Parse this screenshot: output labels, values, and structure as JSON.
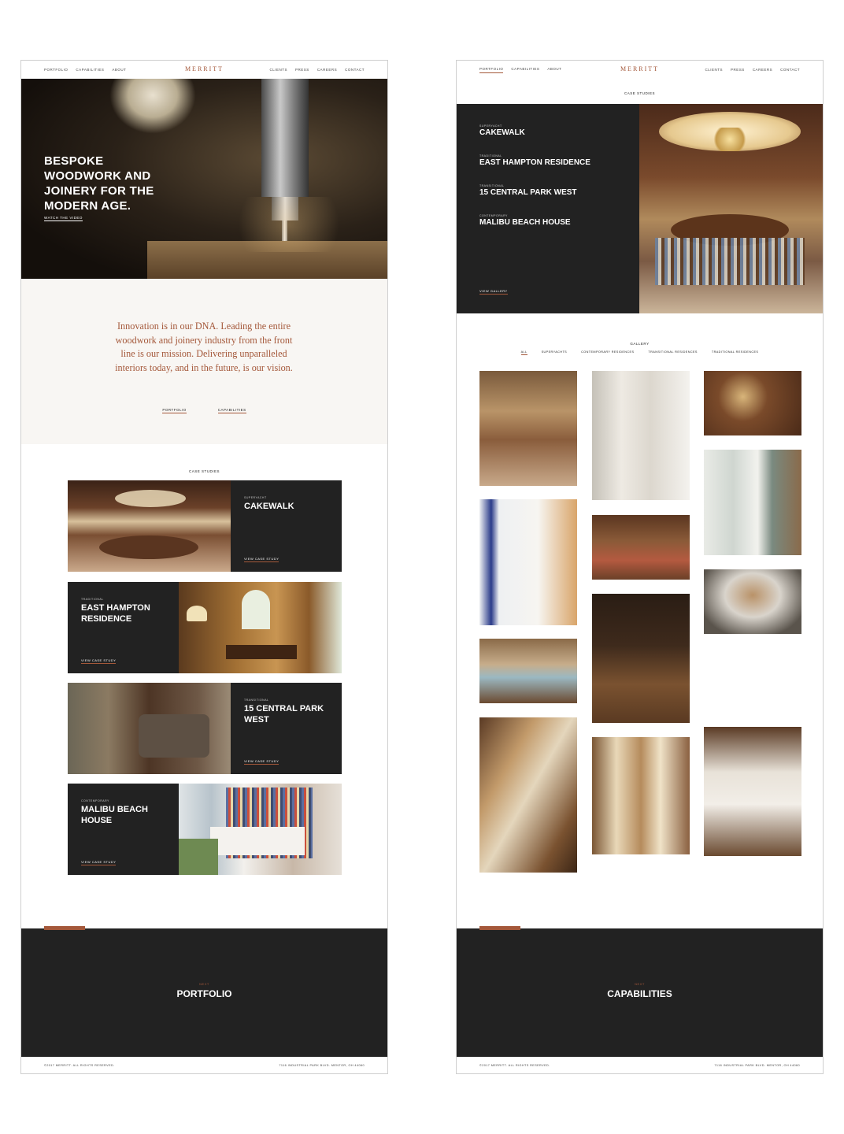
{
  "nav": {
    "left": [
      "PORTFOLIO",
      "CAPABILITIES",
      "ABOUT"
    ],
    "logo": "MERRITT",
    "right": [
      "CLIENTS",
      "PRESS",
      "CAREERS",
      "CONTACT"
    ]
  },
  "home": {
    "hero_title": "BESPOKE WOODWORK AND JOINERY FOR THE MODERN AGE.",
    "watch_video": "WATCH THE VIDEO",
    "intro": "Innovation is in our DNA. Leading the entire woodwork and joinery industry from the front line is our mission. Delivering unparalleled interiors today, and in the future, is our vision.",
    "intro_links": [
      "PORTFOLIO",
      "CAPABILITIES"
    ],
    "case_studies_title": "CASE STUDIES",
    "cases": [
      {
        "category": "SUPERYACHT",
        "name": "CAKEWALK",
        "cta": "VIEW CASE STUDY"
      },
      {
        "category": "TRADITIONAL",
        "name": "EAST HAMPTON RESIDENCE",
        "cta": "VIEW CASE STUDY"
      },
      {
        "category": "TRANSITIONAL",
        "name": "15 CENTRAL PARK WEST",
        "cta": "VIEW CASE STUDY"
      },
      {
        "category": "CONTEMPORARY",
        "name": "MALIBU BEACH HOUSE",
        "cta": "VIEW CASE STUDY"
      }
    ],
    "next_label": "NEXT",
    "next_title": "PORTFOLIO"
  },
  "portfolio": {
    "case_studies_title": "CASE STUDIES",
    "featured": [
      {
        "category": "SUPERYACHT",
        "name": "CAKEWALK"
      },
      {
        "category": "TRADITIONAL",
        "name": "EAST HAMPTON RESIDENCE"
      },
      {
        "category": "TRANSITIONAL",
        "name": "15 CENTRAL PARK WEST"
      },
      {
        "category": "CONTEMPORARY",
        "name": "MALIBU BEACH HOUSE"
      }
    ],
    "view_gallery": "VIEW GALLERY",
    "gallery_title": "GALLERY",
    "filters": [
      "ALL",
      "SUPERYACHTS",
      "CONTEMPORARY RESIDENCES",
      "TRANSITIONAL RESIDENCES",
      "TRADITIONAL RESIDENCES"
    ],
    "next_label": "NEXT",
    "next_title": "CAPABILITIES"
  },
  "footer": {
    "copyright": "©2017 MERRITT. ALL RIGHTS RESERVED.",
    "address": "7116 INDUSTRIAL PARK BLVD. MENTOR, OH 44060"
  },
  "colors": {
    "accent": "#a4583a",
    "dark": "#222222",
    "intro_bg": "#f8f6f3"
  }
}
